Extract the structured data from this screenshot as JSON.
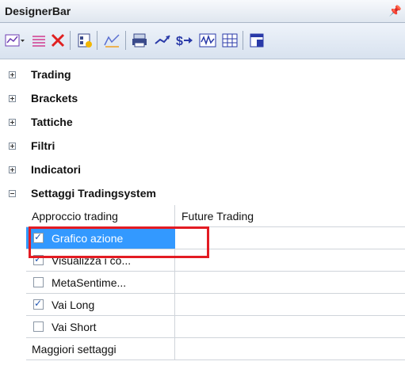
{
  "window": {
    "title": "DesignerBar",
    "pin_icon": "pin-icon"
  },
  "toolbar": {
    "buttons": [
      {
        "icon": "chart-dropdown-icon"
      },
      {
        "icon": "table-lines-icon"
      },
      {
        "icon": "delete-icon"
      },
      {
        "icon": "report-icon"
      },
      {
        "icon": "line-draw-icon"
      },
      {
        "icon": "print-icon"
      },
      {
        "icon": "trend-icon"
      },
      {
        "icon": "dollar-arrow-icon"
      },
      {
        "icon": "waveform-icon"
      },
      {
        "icon": "grid-icon"
      },
      {
        "icon": "properties-icon"
      }
    ]
  },
  "groups": [
    {
      "label": "Trading",
      "expanded": false
    },
    {
      "label": "Brackets",
      "expanded": false
    },
    {
      "label": "Tattiche",
      "expanded": false
    },
    {
      "label": "Filtri",
      "expanded": false
    },
    {
      "label": "Indicatori",
      "expanded": false
    },
    {
      "label": "Settaggi Tradingsystem",
      "expanded": true
    }
  ],
  "settings": {
    "approccio": {
      "label": "Approccio trading",
      "value": "Future Trading"
    },
    "rows": [
      {
        "label": "Grafico azione",
        "checked": true,
        "selected": true
      },
      {
        "label": "Visualizza i co...",
        "checked": true
      },
      {
        "label": "MetaSentime...",
        "checked": false
      },
      {
        "label": "Vai Long",
        "checked": true
      },
      {
        "label": "Vai Short",
        "checked": false
      }
    ],
    "more": {
      "label": "Maggiori settaggi"
    }
  },
  "colors": {
    "selection": "#3399ff",
    "highlight_border": "#e31b23"
  }
}
